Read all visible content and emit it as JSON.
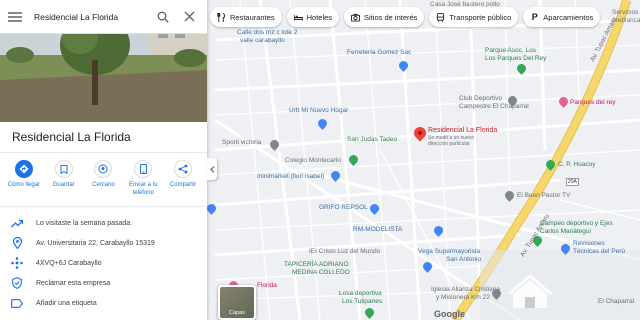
{
  "search": {
    "value": "Residencial La Florida"
  },
  "place": {
    "title": "Residencial La Florida",
    "actions": [
      {
        "label_lines": [
          "Cómo llegar"
        ]
      },
      {
        "label_lines": [
          "Guardar"
        ]
      },
      {
        "label_lines": [
          "Cercano"
        ]
      },
      {
        "label_lines": [
          "Enviar a tu",
          "teléfono"
        ]
      },
      {
        "label_lines": [
          "Compartir"
        ]
      }
    ],
    "info": [
      {
        "icon": "trending-icon",
        "text": "Lo visitaste la semana pasada."
      },
      {
        "icon": "location-pin-icon",
        "text": "Av. Universitaria 22, Carabayllo 15319"
      },
      {
        "icon": "plus-code-icon",
        "text": "4XVQ+6J Carabayllo"
      },
      {
        "icon": "verified-shield-icon",
        "text": "Reclamar esta empresa"
      },
      {
        "icon": "label-icon",
        "text": "Añadir una etiqueta"
      }
    ]
  },
  "chips": [
    {
      "icon": "restaurant-icon",
      "label": "Restaurantes"
    },
    {
      "icon": "hotel-icon",
      "label": "Hoteles"
    },
    {
      "icon": "camera-icon",
      "label": "Sitios de interés"
    },
    {
      "icon": "transit-icon",
      "label": "Transporte público"
    },
    {
      "icon": "parking-icon",
      "label": "Aparcamientos"
    }
  ],
  "map_labels": {
    "casa": "Casa José bastero pollo",
    "servicios_1": "Servicios",
    "servicios_2": "oreblanca",
    "calle_a": "Calle dos mz c lote 2",
    "calle_b": "valle carabayllo",
    "ferreteria": "Ferretería Gomez Sac",
    "parque_asoc_1": "Parque Asoc. Los",
    "parque_asoc_2": "Los Parques Del Rey",
    "club_1": "Club Deportivo",
    "club_2": "Campestre El Chaparral",
    "parques_rey": "Parques del rey",
    "urb": "Urb Mi Nuevo Hogar",
    "residencial": "Residencial La Florida",
    "residencial_sub1": "Se mudó a un nuevo",
    "residencial_sub2": "dirección particular",
    "san_judas": "San Judas Tadeo",
    "sporti": "Sporti victoria",
    "colegio": "Colegio Montecarlo",
    "cp_huacoy": "C. P. Huacoy",
    "minimarket": "minimarket (fiori isabel)",
    "grifo": "GRIFO REPSOL",
    "buen_pastor": "El Buen Pastor TV",
    "rm_modelista": "RM-MODELISTA",
    "campeo_1": "Campeo deportivo y Ejes",
    "campeo_2": "Carlos Mariátegui",
    "ie_cristo": "IEI Cristo Luz del Mundo",
    "vega_1": "Vega Supermayorista",
    "vega_2": "San Antonio",
    "revisiones_1": "Revisiones",
    "revisiones_2": "Técnicas del Perú",
    "tapiceria_1": "TAPICERÍA ADRIANO",
    "tapiceria_2": "MEDINA COLLEDO",
    "losa_1": "Losa deportiva",
    "losa_2": "Los Tulipanes",
    "iglesia_1": "Iglesia Alianza Cristiana",
    "iglesia_2": "y Misionera Km 22",
    "florida": "Florida",
    "chaparral": "El Chaparral",
    "tupac_1": "Av. Tupac Amaru",
    "tupac_2": "Av. Tupac Amaru",
    "hwy": "20A"
  },
  "layers_label": "Capas",
  "logo": "Google",
  "colors": {
    "accent": "#1a73e8",
    "pin": "#ea4335",
    "highway": "#f5d76e"
  }
}
